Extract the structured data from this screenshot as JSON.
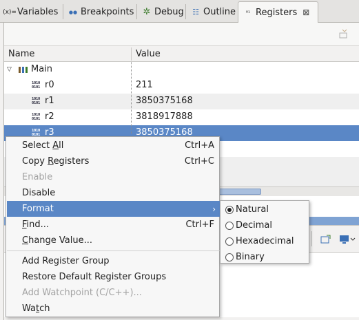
{
  "tabs": [
    {
      "label": "Variables",
      "icon": "variables-icon",
      "glyph": "(x)="
    },
    {
      "label": "Breakpoints",
      "icon": "breakpoints-icon",
      "glyph": "●●"
    },
    {
      "label": "Debug",
      "icon": "debug-icon",
      "glyph": "✲"
    },
    {
      "label": "Outline",
      "icon": "outline-icon",
      "glyph": "☷"
    },
    {
      "label": "Registers",
      "icon": "registers-icon",
      "glyph": "⁰¹",
      "active": true
    }
  ],
  "table": {
    "columns": [
      "Name",
      "Value"
    ],
    "group": {
      "name": "Main"
    },
    "rows": [
      {
        "name": "r0",
        "value": "211"
      },
      {
        "name": "r1",
        "value": "3850375168"
      },
      {
        "name": "r2",
        "value": "3818917888"
      },
      {
        "name": "r3",
        "value": "3850375168",
        "selected": true
      }
    ]
  },
  "menu": {
    "items": [
      {
        "pre": "Select ",
        "u": "A",
        "post": "ll",
        "accel": "Ctrl+A"
      },
      {
        "pre": "Copy ",
        "u": "R",
        "post": "egisters",
        "accel": "Ctrl+C"
      },
      {
        "pre": "Enable",
        "u": "",
        "post": "",
        "accel": "",
        "disabled": true
      },
      {
        "pre": "Disable",
        "u": "",
        "post": "",
        "accel": ""
      },
      {
        "pre": "Format",
        "u": "",
        "post": "",
        "accel": "",
        "submenu": true
      },
      {
        "pre": "",
        "u": "F",
        "post": "ind...",
        "accel": "Ctrl+F"
      },
      {
        "pre": "",
        "u": "C",
        "post": "hange Value...",
        "accel": ""
      },
      {
        "pre": "Add Register Group",
        "u": "",
        "post": "",
        "accel": ""
      },
      {
        "pre": "Restore Default Register Groups",
        "u": "",
        "post": "",
        "accel": ""
      },
      {
        "pre": "Add Watchpoint (C/C++)...",
        "u": "",
        "post": "",
        "accel": "",
        "disabled": true
      },
      {
        "pre": "Wa",
        "u": "t",
        "post": "ch",
        "accel": ""
      }
    ],
    "submenu_arrow": "›"
  },
  "format_submenu": {
    "options": [
      "Natural",
      "Decimal",
      "Hexadecimal",
      "Binary"
    ],
    "selected": "Natural"
  },
  "icons": {
    "register_glyph_top": "1010",
    "register_glyph_bottom": "0101",
    "close": "⊠",
    "expand": "▽"
  },
  "colors": {
    "selection": "#5a87c6",
    "accent_band": "#7fa3d3"
  }
}
